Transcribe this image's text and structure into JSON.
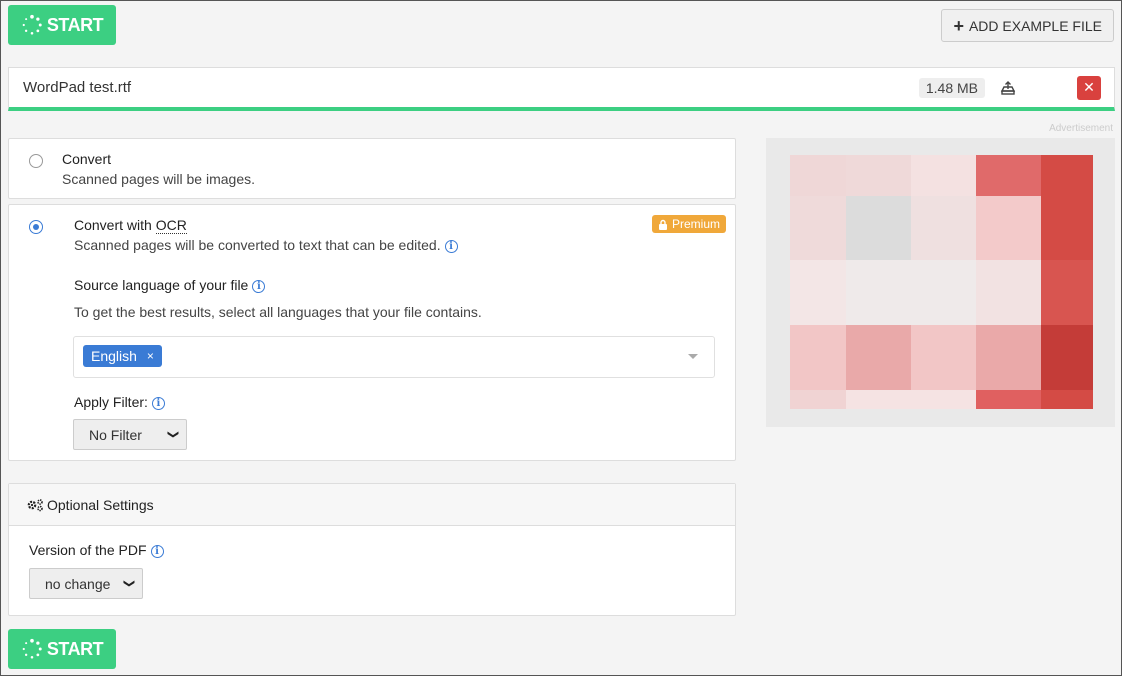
{
  "start": {
    "label": "START"
  },
  "toolbar": {
    "add_example_label": "ADD EXAMPLE FILE"
  },
  "file": {
    "name": "WordPad test.rtf",
    "size": "1.48 MB"
  },
  "ad": {
    "label": "Advertisement"
  },
  "options": {
    "convert": {
      "title": "Convert",
      "description": "Scanned pages will be images.",
      "selected": false
    },
    "ocr": {
      "title_prefix": "Convert with ",
      "title_abbr": "OCR",
      "description": "Scanned pages will be converted to text that can be edited.",
      "badge": "Premium",
      "selected": true,
      "source_language_label": "Source language of your file",
      "source_language_hint": "To get the best results, select all languages that your file contains.",
      "languages": [
        "English"
      ],
      "filter_label": "Apply Filter:",
      "filter_value": "No Filter"
    }
  },
  "optional_settings": {
    "title": "Optional Settings",
    "pdf_version_label": "Version of the PDF",
    "pdf_version_value": "no change"
  },
  "colors": {
    "accent_green": "#3ccf82",
    "primary_blue": "#3a7bd5",
    "danger_red": "#d9413e",
    "premium_orange": "#f0a83a"
  }
}
